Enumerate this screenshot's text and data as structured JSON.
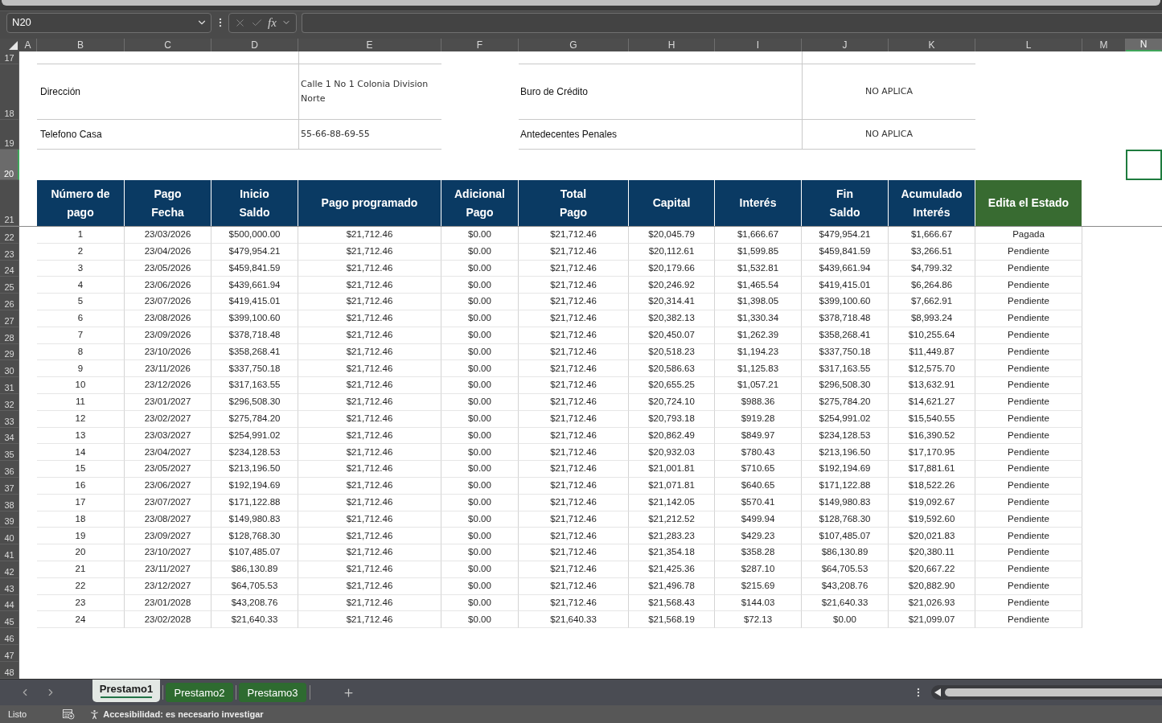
{
  "name_box": {
    "value": "N20"
  },
  "formula_bar": {
    "function_label": "fx"
  },
  "columns": [
    {
      "label": "A",
      "selected": false
    },
    {
      "label": "B",
      "selected": false
    },
    {
      "label": "C",
      "selected": false
    },
    {
      "label": "D",
      "selected": false
    },
    {
      "label": "E",
      "selected": false
    },
    {
      "label": "F",
      "selected": false
    },
    {
      "label": "G",
      "selected": false
    },
    {
      "label": "H",
      "selected": false
    },
    {
      "label": "I",
      "selected": false
    },
    {
      "label": "J",
      "selected": false
    },
    {
      "label": "K",
      "selected": false
    },
    {
      "label": "L",
      "selected": false
    },
    {
      "label": "M",
      "selected": false
    },
    {
      "label": "N",
      "selected": true
    }
  ],
  "row_headers": [
    {
      "label": "17",
      "selected": false
    },
    {
      "label": "18",
      "selected": false
    },
    {
      "label": "19",
      "selected": false
    },
    {
      "label": "20",
      "selected": true
    },
    {
      "label": "21",
      "selected": false
    },
    {
      "label": "22",
      "selected": false
    },
    {
      "label": "23",
      "selected": false
    },
    {
      "label": "24",
      "selected": false
    },
    {
      "label": "25",
      "selected": false
    },
    {
      "label": "26",
      "selected": false
    },
    {
      "label": "27",
      "selected": false
    },
    {
      "label": "28",
      "selected": false
    },
    {
      "label": "29",
      "selected": false
    },
    {
      "label": "30",
      "selected": false
    },
    {
      "label": "31",
      "selected": false
    },
    {
      "label": "32",
      "selected": false
    },
    {
      "label": "33",
      "selected": false
    },
    {
      "label": "34",
      "selected": false
    },
    {
      "label": "35",
      "selected": false
    },
    {
      "label": "36",
      "selected": false
    },
    {
      "label": "37",
      "selected": false
    },
    {
      "label": "38",
      "selected": false
    },
    {
      "label": "39",
      "selected": false
    },
    {
      "label": "40",
      "selected": false
    },
    {
      "label": "41",
      "selected": false
    },
    {
      "label": "42",
      "selected": false
    },
    {
      "label": "43",
      "selected": false
    },
    {
      "label": "44",
      "selected": false
    },
    {
      "label": "45",
      "selected": false
    },
    {
      "label": "46",
      "selected": false
    },
    {
      "label": "47",
      "selected": false
    },
    {
      "label": "48",
      "selected": false
    }
  ],
  "info_rows": [
    {
      "label": "Dirección",
      "value": "Calle 1 No 1 Colonia Division Norte",
      "check_label": "Buro de Crédito",
      "check_value": "NO APLICA"
    },
    {
      "label": "Telefono Casa",
      "value": "55-66-88-69-55",
      "check_label": "Antedecentes Penales",
      "check_value": "NO APLICA"
    }
  ],
  "table": {
    "columns": [
      {
        "label": "Número de\npago",
        "color": "#0a3a63"
      },
      {
        "label": "Pago\nFecha",
        "color": "#0a3a63"
      },
      {
        "label": "Inicio\nSaldo",
        "color": "#0a3a63"
      },
      {
        "label": "Pago programado",
        "color": "#0a3a63"
      },
      {
        "label": "Adicional\nPago",
        "color": "#0a3a63"
      },
      {
        "label": "Total\nPago",
        "color": "#0a3a63"
      },
      {
        "label": "Capital",
        "color": "#0a3a63"
      },
      {
        "label": "Interés",
        "color": "#0a3a63"
      },
      {
        "label": "Fin\nSaldo",
        "color": "#0a3a63"
      },
      {
        "label": "Acumulado\nInterés",
        "color": "#0a3a63"
      },
      {
        "label": "Edita el Estado",
        "color": "#386b31"
      }
    ],
    "rows": [
      [
        "1",
        "23/03/2026",
        "$500,000.00",
        "$21,712.46",
        "$0.00",
        "$21,712.46",
        "$20,045.79",
        "$1,666.67",
        "$479,954.21",
        "$1,666.67",
        "Pagada"
      ],
      [
        "2",
        "23/04/2026",
        "$479,954.21",
        "$21,712.46",
        "$0.00",
        "$21,712.46",
        "$20,112.61",
        "$1,599.85",
        "$459,841.59",
        "$3,266.51",
        "Pendiente"
      ],
      [
        "3",
        "23/05/2026",
        "$459,841.59",
        "$21,712.46",
        "$0.00",
        "$21,712.46",
        "$20,179.66",
        "$1,532.81",
        "$439,661.94",
        "$4,799.32",
        "Pendiente"
      ],
      [
        "4",
        "23/06/2026",
        "$439,661.94",
        "$21,712.46",
        "$0.00",
        "$21,712.46",
        "$20,246.92",
        "$1,465.54",
        "$419,415.01",
        "$6,264.86",
        "Pendiente"
      ],
      [
        "5",
        "23/07/2026",
        "$419,415.01",
        "$21,712.46",
        "$0.00",
        "$21,712.46",
        "$20,314.41",
        "$1,398.05",
        "$399,100.60",
        "$7,662.91",
        "Pendiente"
      ],
      [
        "6",
        "23/08/2026",
        "$399,100.60",
        "$21,712.46",
        "$0.00",
        "$21,712.46",
        "$20,382.13",
        "$1,330.34",
        "$378,718.48",
        "$8,993.24",
        "Pendiente"
      ],
      [
        "7",
        "23/09/2026",
        "$378,718.48",
        "$21,712.46",
        "$0.00",
        "$21,712.46",
        "$20,450.07",
        "$1,262.39",
        "$358,268.41",
        "$10,255.64",
        "Pendiente"
      ],
      [
        "8",
        "23/10/2026",
        "$358,268.41",
        "$21,712.46",
        "$0.00",
        "$21,712.46",
        "$20,518.23",
        "$1,194.23",
        "$337,750.18",
        "$11,449.87",
        "Pendiente"
      ],
      [
        "9",
        "23/11/2026",
        "$337,750.18",
        "$21,712.46",
        "$0.00",
        "$21,712.46",
        "$20,586.63",
        "$1,125.83",
        "$317,163.55",
        "$12,575.70",
        "Pendiente"
      ],
      [
        "10",
        "23/12/2026",
        "$317,163.55",
        "$21,712.46",
        "$0.00",
        "$21,712.46",
        "$20,655.25",
        "$1,057.21",
        "$296,508.30",
        "$13,632.91",
        "Pendiente"
      ],
      [
        "11",
        "23/01/2027",
        "$296,508.30",
        "$21,712.46",
        "$0.00",
        "$21,712.46",
        "$20,724.10",
        "$988.36",
        "$275,784.20",
        "$14,621.27",
        "Pendiente"
      ],
      [
        "12",
        "23/02/2027",
        "$275,784.20",
        "$21,712.46",
        "$0.00",
        "$21,712.46",
        "$20,793.18",
        "$919.28",
        "$254,991.02",
        "$15,540.55",
        "Pendiente"
      ],
      [
        "13",
        "23/03/2027",
        "$254,991.02",
        "$21,712.46",
        "$0.00",
        "$21,712.46",
        "$20,862.49",
        "$849.97",
        "$234,128.53",
        "$16,390.52",
        "Pendiente"
      ],
      [
        "14",
        "23/04/2027",
        "$234,128.53",
        "$21,712.46",
        "$0.00",
        "$21,712.46",
        "$20,932.03",
        "$780.43",
        "$213,196.50",
        "$17,170.95",
        "Pendiente"
      ],
      [
        "15",
        "23/05/2027",
        "$213,196.50",
        "$21,712.46",
        "$0.00",
        "$21,712.46",
        "$21,001.81",
        "$710.65",
        "$192,194.69",
        "$17,881.61",
        "Pendiente"
      ],
      [
        "16",
        "23/06/2027",
        "$192,194.69",
        "$21,712.46",
        "$0.00",
        "$21,712.46",
        "$21,071.81",
        "$640.65",
        "$171,122.88",
        "$18,522.26",
        "Pendiente"
      ],
      [
        "17",
        "23/07/2027",
        "$171,122.88",
        "$21,712.46",
        "$0.00",
        "$21,712.46",
        "$21,142.05",
        "$570.41",
        "$149,980.83",
        "$19,092.67",
        "Pendiente"
      ],
      [
        "18",
        "23/08/2027",
        "$149,980.83",
        "$21,712.46",
        "$0.00",
        "$21,712.46",
        "$21,212.52",
        "$499.94",
        "$128,768.30",
        "$19,592.60",
        "Pendiente"
      ],
      [
        "19",
        "23/09/2027",
        "$128,768.30",
        "$21,712.46",
        "$0.00",
        "$21,712.46",
        "$21,283.23",
        "$429.23",
        "$107,485.07",
        "$20,021.83",
        "Pendiente"
      ],
      [
        "20",
        "23/10/2027",
        "$107,485.07",
        "$21,712.46",
        "$0.00",
        "$21,712.46",
        "$21,354.18",
        "$358.28",
        "$86,130.89",
        "$20,380.11",
        "Pendiente"
      ],
      [
        "21",
        "23/11/2027",
        "$86,130.89",
        "$21,712.46",
        "$0.00",
        "$21,712.46",
        "$21,425.36",
        "$287.10",
        "$64,705.53",
        "$20,667.22",
        "Pendiente"
      ],
      [
        "22",
        "23/12/2027",
        "$64,705.53",
        "$21,712.46",
        "$0.00",
        "$21,712.46",
        "$21,496.78",
        "$215.69",
        "$43,208.76",
        "$20,882.90",
        "Pendiente"
      ],
      [
        "23",
        "23/01/2028",
        "$43,208.76",
        "$21,712.46",
        "$0.00",
        "$21,712.46",
        "$21,568.43",
        "$144.03",
        "$21,640.33",
        "$21,026.93",
        "Pendiente"
      ],
      [
        "24",
        "23/02/2028",
        "$21,640.33",
        "$21,712.46",
        "$0.00",
        "$21,640.33",
        "$21,568.19",
        "$72.13",
        "$0.00",
        "$21,099.07",
        "Pendiente"
      ]
    ]
  },
  "sheet_tabs": [
    {
      "label": "Prestamo1",
      "selected": true
    },
    {
      "label": "Prestamo2",
      "selected": false
    },
    {
      "label": "Prestamo3",
      "selected": false
    }
  ],
  "status_bar": {
    "status": "Listo",
    "accessibility": "Accesibilidad: es necesario investigar"
  }
}
